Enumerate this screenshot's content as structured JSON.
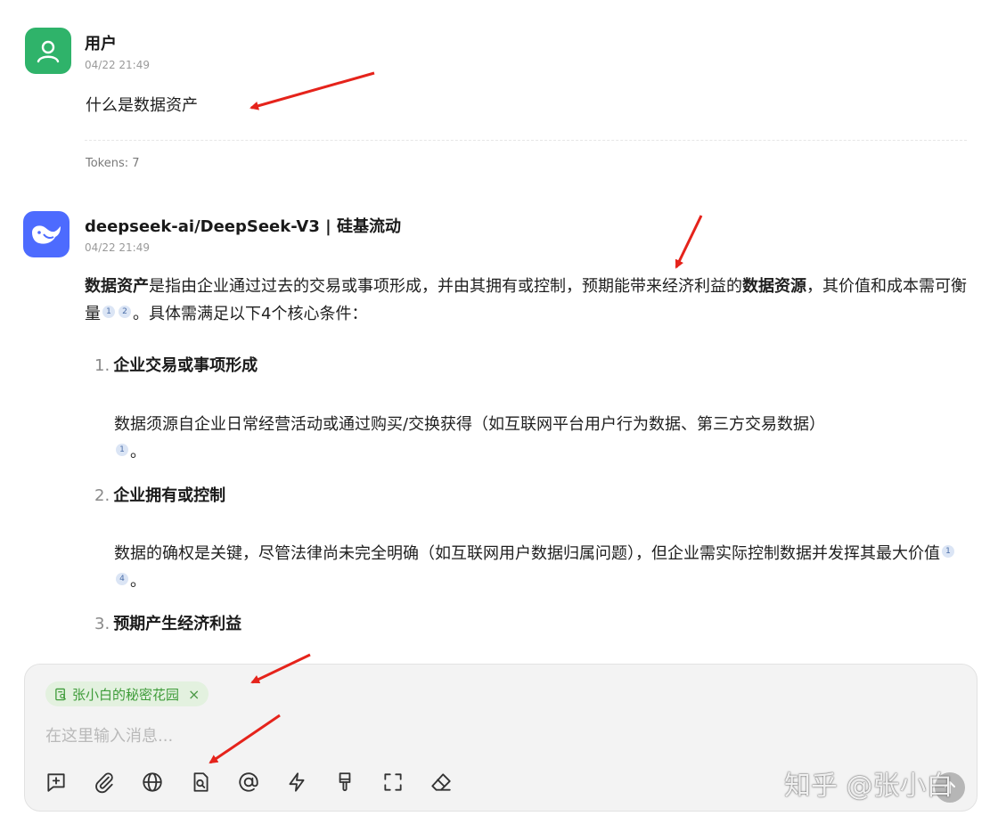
{
  "user_message": {
    "sender": "用户",
    "time": "04/22 21:49",
    "text": "什么是数据资产",
    "tokens": "Tokens: 7"
  },
  "assistant_message": {
    "sender": "deepseek-ai/DeepSeek-V3 | 硅基流动",
    "time": "04/22 21:49",
    "intro": {
      "term": "数据资产",
      "part1": "是指由企业通过过去的交易或事项形成，并由其拥有或控制，预期能带来经济利益的",
      "term2": "数据资源",
      "part2": "，其价值和成本需可衡量",
      "cite_a": "1",
      "cite_b": "2",
      "part3": "。具体需满足以下4个核心条件："
    },
    "items": [
      {
        "num": "1.",
        "title": "企业交易或事项形成",
        "body": "数据须源自企业日常经营活动或通过购买/交换获得（如互联网平台用户行为数据、第三方交易数据）",
        "cites": [
          "1"
        ],
        "end": "。"
      },
      {
        "num": "2.",
        "title": "企业拥有或控制",
        "body": "数据的确权是关键，尽管法律尚未完全明确（如互联网用户数据归属问题），但企业需实际控制数据并发挥其最大价值",
        "cites": [
          "1",
          "4"
        ],
        "end": "。"
      },
      {
        "num": "3.",
        "title": "预期产生经济利益"
      }
    ]
  },
  "composer": {
    "knowledge_chip": "张小白的秘密花园",
    "chip_close": "×",
    "placeholder": "在这里输入消息...",
    "toolbar_icons": [
      "new-topic-icon",
      "attachment-icon",
      "web-search-icon",
      "knowledge-base-icon",
      "mention-model-icon",
      "quick-phrase-icon",
      "brush-icon",
      "fullscreen-icon",
      "clear-icon"
    ]
  },
  "watermark": "知乎 @张小白",
  "colors": {
    "user_avatar": "#2fb36a",
    "assistant_avatar": "#4d6bfe",
    "chip_bg": "#e3f1df",
    "chip_text": "#3f9c3a",
    "annotation_arrow": "#e5231b"
  }
}
